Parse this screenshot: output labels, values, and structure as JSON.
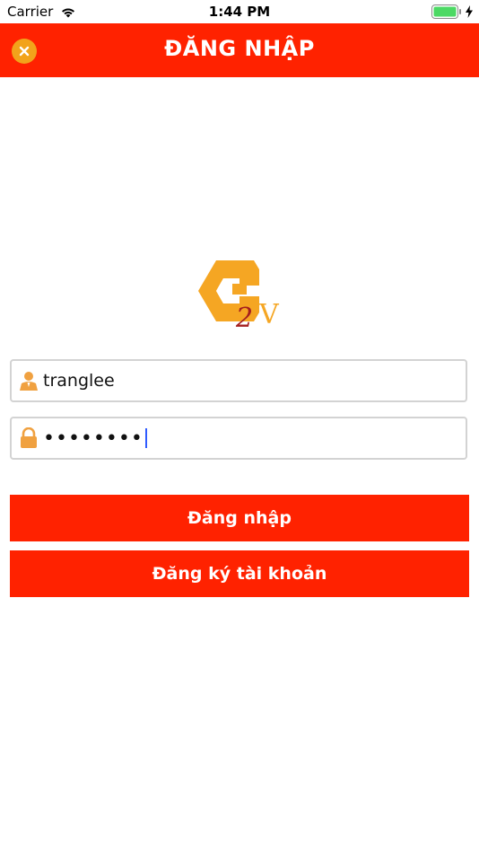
{
  "status_bar": {
    "carrier": "Carrier",
    "time": "1:44 PM",
    "battery_color": "#4cd964"
  },
  "header": {
    "title": "ĐĂNG NHẬP",
    "background": "#ff2200",
    "close_icon": "close-icon"
  },
  "logo": {
    "letter": "C",
    "number": "2",
    "suffix": "V",
    "primary_color": "#f5a623",
    "accent_color": "#a41e1e"
  },
  "login_form": {
    "username": {
      "icon": "user-icon",
      "value": "tranglee"
    },
    "password": {
      "icon": "lock-icon",
      "masked_value": "••••••••"
    }
  },
  "buttons": {
    "login_label": "Đăng nhập",
    "register_label": "Đăng ký tài khoản"
  }
}
